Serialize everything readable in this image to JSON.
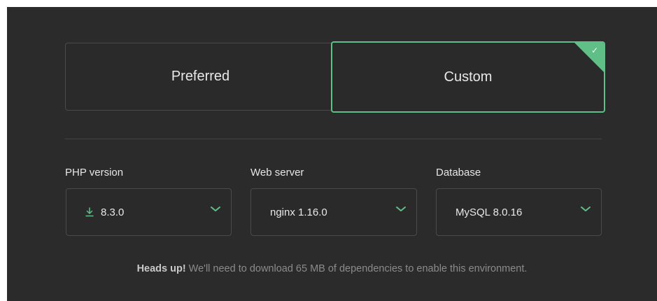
{
  "modes": {
    "preferred_label": "Preferred",
    "custom_label": "Custom",
    "selected": "Custom"
  },
  "fields": {
    "php": {
      "label": "PHP version",
      "value": "8.3.0",
      "icon": "download-icon"
    },
    "web": {
      "label": "Web server",
      "value": "nginx 1.16.0"
    },
    "db": {
      "label": "Database",
      "value": "MySQL 8.0.16"
    }
  },
  "notice": {
    "bold": "Heads up!",
    "text": " We'll need to download 65 MB of dependencies to enable this environment."
  },
  "colors": {
    "accent": "#5fbf86",
    "background": "#2b2b2b"
  }
}
